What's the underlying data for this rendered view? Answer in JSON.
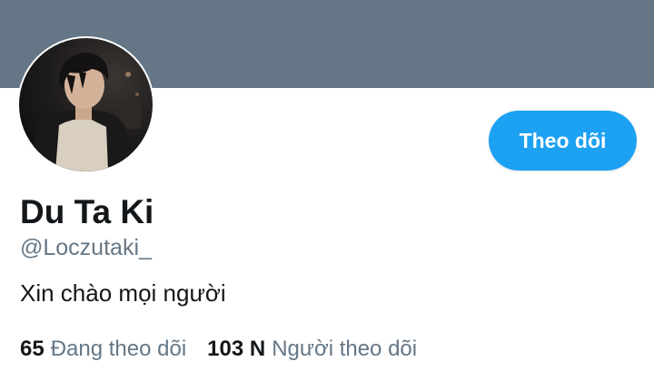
{
  "profile": {
    "display_name": "Du Ta Ki",
    "handle": "@Loczutaki_",
    "bio": "Xin chào mọi người"
  },
  "actions": {
    "follow_label": "Theo dõi"
  },
  "stats": {
    "following_count": "65",
    "following_label": "Đang theo dõi",
    "followers_count": "103 N",
    "followers_label": "Người theo dõi"
  },
  "colors": {
    "banner": "#657786",
    "accent": "#1da1f2",
    "text_primary": "#14171a",
    "text_secondary": "#657786"
  },
  "icons": {
    "avatar": "profile-photo"
  }
}
